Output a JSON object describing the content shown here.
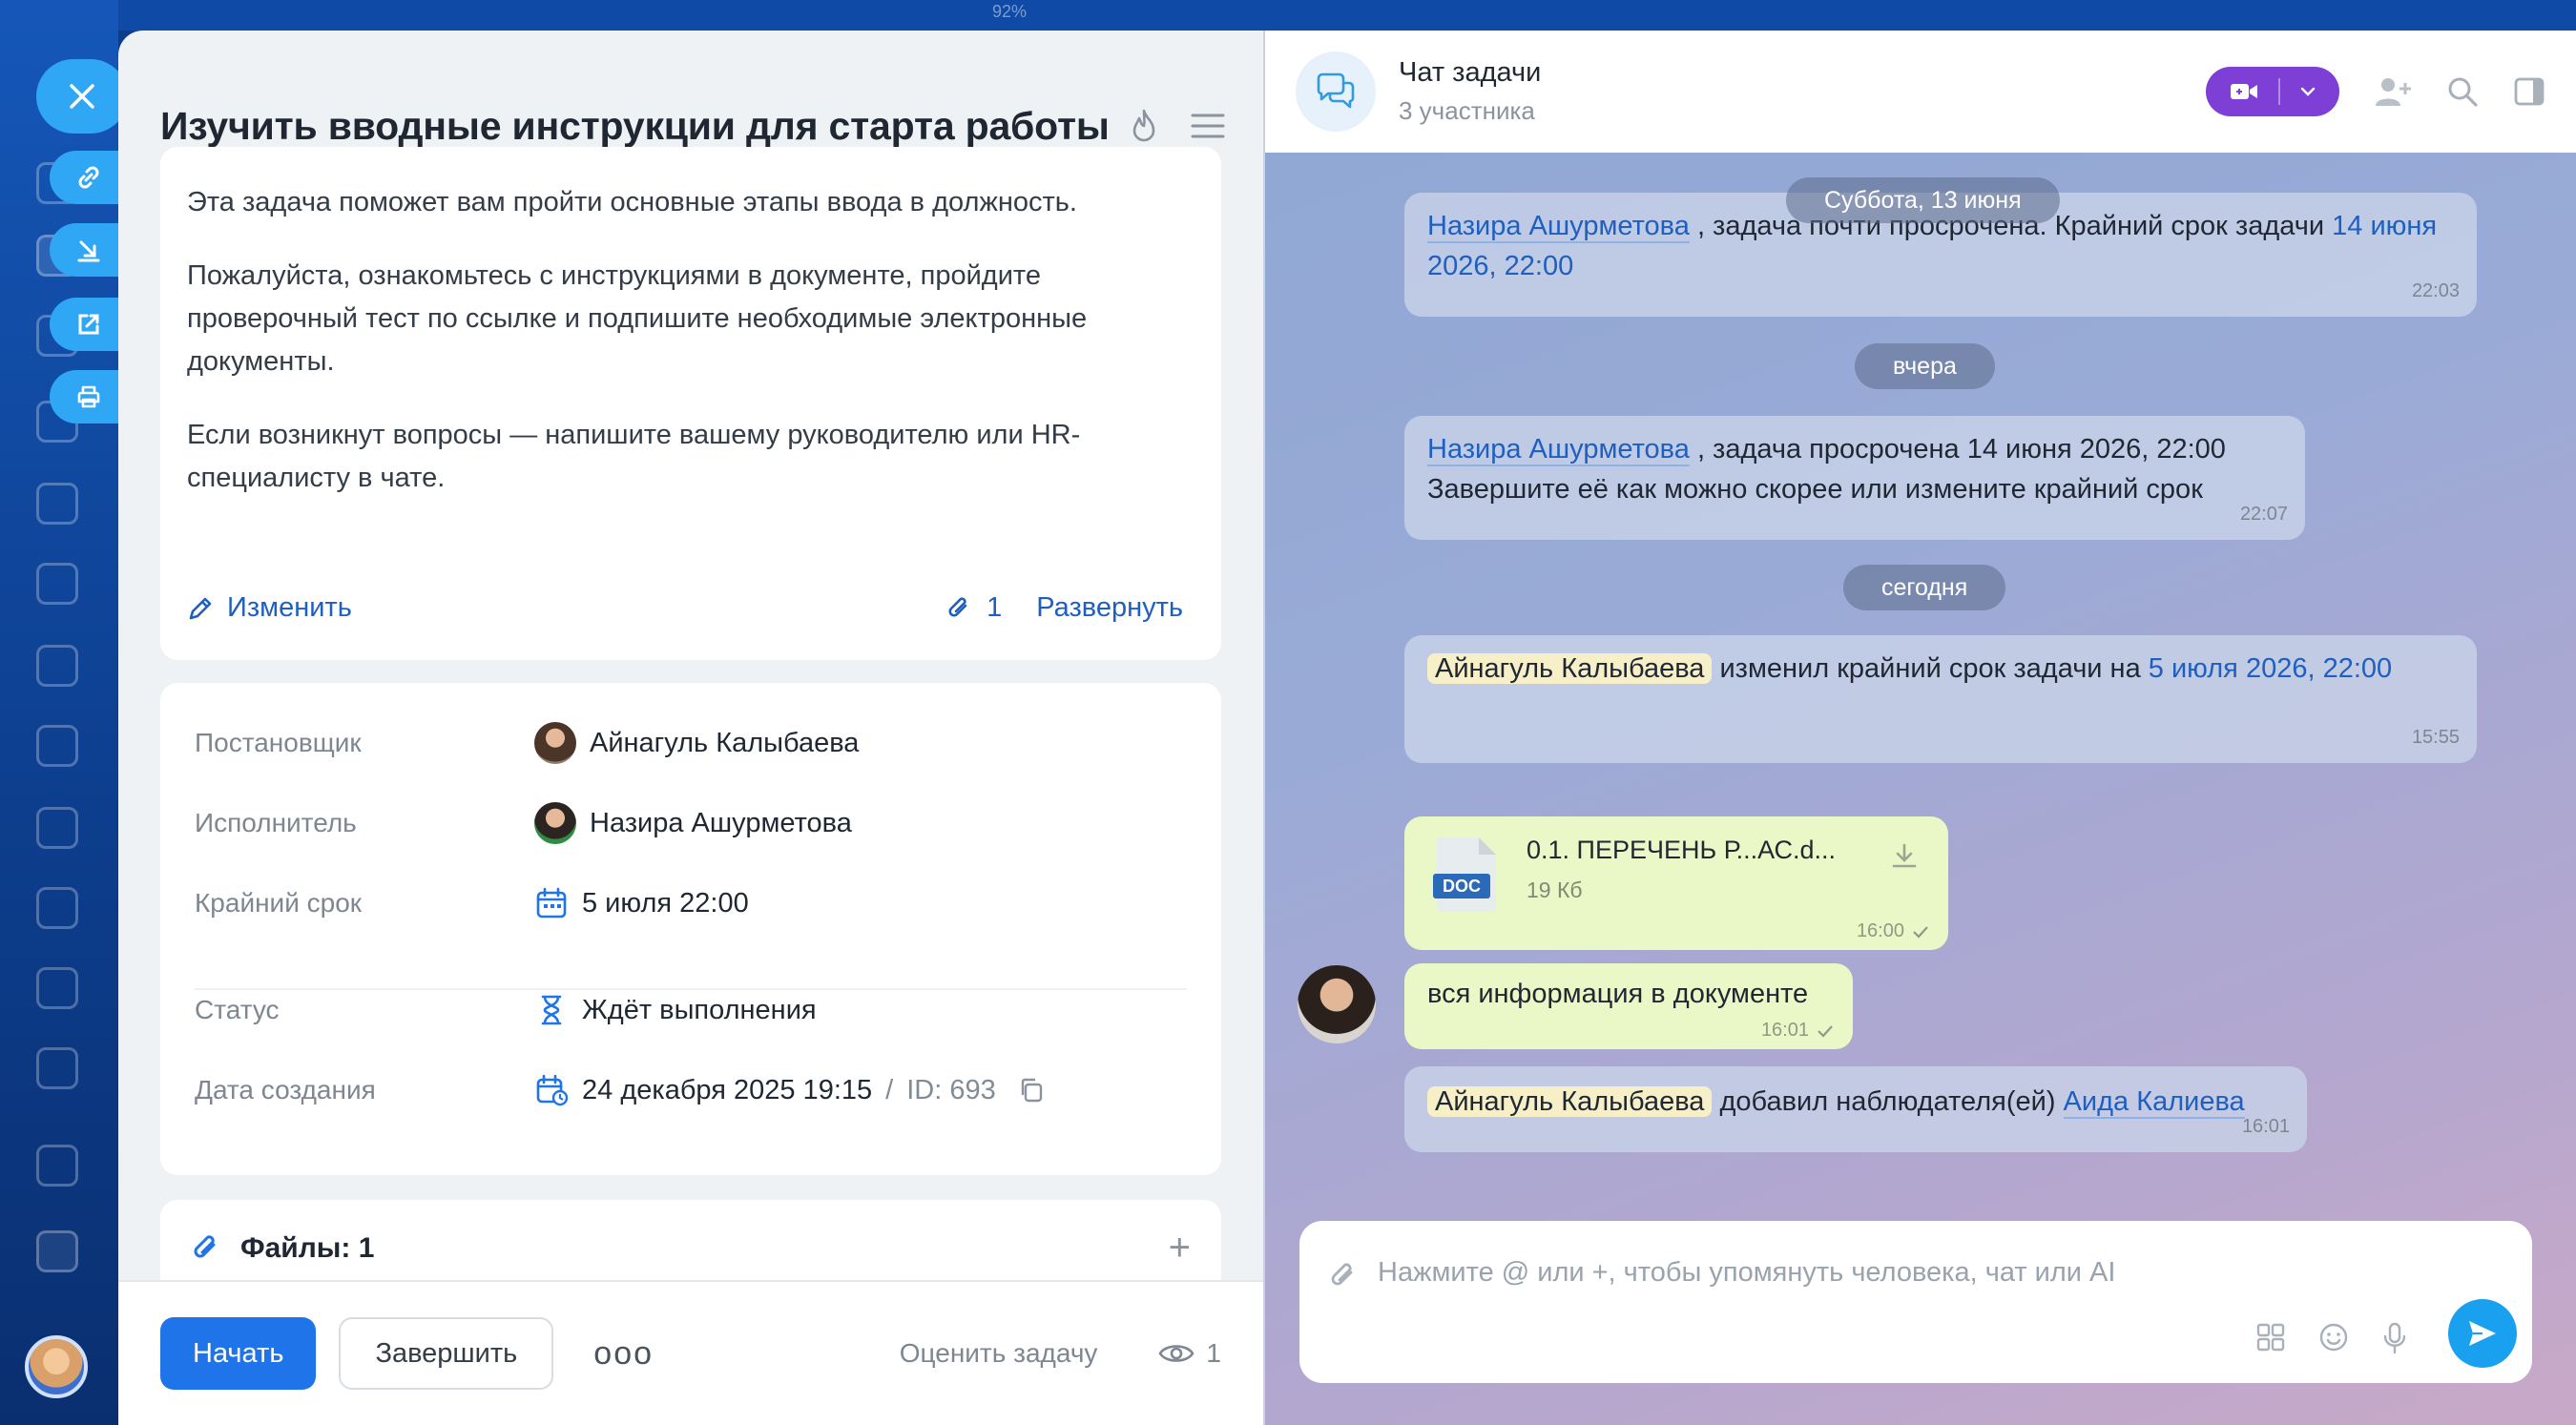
{
  "top_bar": {
    "zoom": "92%"
  },
  "task": {
    "title": "Изучить вводные инструкции для старта работы",
    "description": [
      "Эта задача поможет вам пройти основные этапы ввода в должность.",
      "Пожалуйста, ознакомьтесь с инструкциями в документе, пройдите проверочный тест по ссылке и подпишите необходимые электронные документы.",
      "Если возникнут вопросы — напишите вашему руководителю или HR-специалисту в чате."
    ],
    "edit_label": "Изменить",
    "attachments_count": "1",
    "expand_label": "Развернуть",
    "fields": {
      "creator_label": "Постановщик",
      "creator_value": "Айнагуль Калыбаева",
      "assignee_label": "Исполнитель",
      "assignee_value": "Назира Ашурметова",
      "deadline_label": "Крайний срок",
      "deadline_value": "5 июля 22:00",
      "status_label": "Статус",
      "status_value": "Ждёт выполнения",
      "created_label": "Дата создания",
      "created_value": "24 декабря 2025 19:15",
      "separator": "/",
      "id_value": "ID: 693"
    },
    "files_label": "Файлы: 1",
    "footer": {
      "start_label": "Начать",
      "finish_label": "Завершить",
      "more_label": "ooo",
      "rate_label": "Оценить задачу",
      "views_count": "1"
    }
  },
  "chat": {
    "title": "Чат задачи",
    "subtitle": "3 участника",
    "dates": {
      "d1": "Суббота, 13 июня",
      "d2": "вчера",
      "d3": "сегодня"
    },
    "messages": {
      "m1": {
        "author": "Назира Ашурметова",
        "text": ", задача почти просрочена. Крайний срок задачи",
        "due": "14 июня 2026, 22:00",
        "time": "22:03"
      },
      "m2": {
        "author": "Назира Ашурметова",
        "text": ", задача просрочена 14 июня 2026, 22:00",
        "text2": "Завершите её как можно скорее или измените крайний срок",
        "time": "22:07"
      },
      "m3": {
        "author": "Айнагуль Калыбаева",
        "text": "изменил крайний срок задачи на",
        "due": "5 июля 2026, 22:00",
        "time": "15:55"
      },
      "file": {
        "name": "0.1. ПЕРЕЧЕНЬ Р...АС.d...",
        "size": "19 Кб",
        "type": "DOC",
        "time": "16:00"
      },
      "text": {
        "body": "вся информация в документе",
        "time": "16:01"
      },
      "m4": {
        "author": "Айнагуль Калыбаева",
        "text": "добавил наблюдателя(ей)",
        "target": "Аида Калиева",
        "time": "16:01"
      }
    },
    "composer_placeholder": "Нажмите @ или +, чтобы упомянуть человека, чат или AI"
  },
  "colors": {
    "accent": "#1e74e8",
    "link": "#1e5fbf",
    "call_button": "#7e3fd6",
    "own_bubble": "#e9f8c6",
    "send_button": "#19a1f0"
  }
}
